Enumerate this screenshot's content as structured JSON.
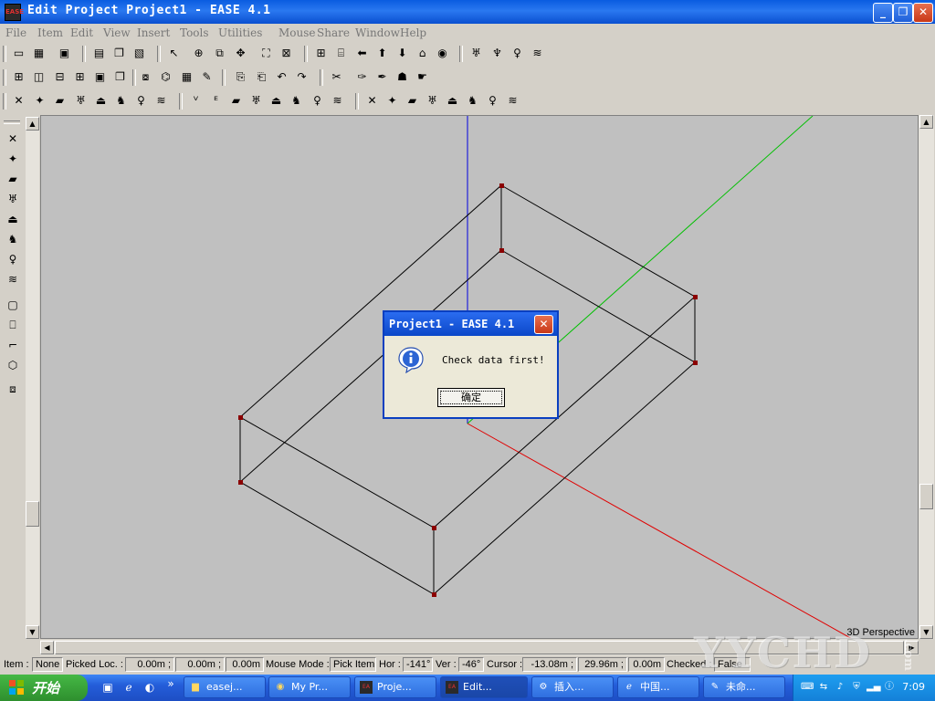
{
  "window": {
    "title": "Edit Project Project1 - EASE 4.1",
    "logo_text": "EASE",
    "controls": {
      "minimize": "_",
      "maximize": "❐",
      "close": "✕"
    }
  },
  "menu": [
    "File",
    "Item",
    "Edit",
    "View",
    "Insert",
    "Tools",
    "Utilities",
    "Mouse",
    "Share",
    "Window",
    "Help"
  ],
  "toolbars": {
    "row1": [
      "new-icon",
      "open-icon",
      "save-icon",
      "print-icon",
      "copy-icon",
      "paste-icon",
      "pick-icon",
      "target-icon",
      "zoom-box-icon",
      "move-icon",
      "fit-icon",
      "fullscreen-icon",
      "grid-icon",
      "table-icon",
      "arrow-left-icon",
      "arrow-up-icon",
      "arrow-down-icon",
      "home-icon",
      "globe-icon",
      "speaker-icon",
      "speaker-array-icon",
      "lamp-icon",
      "wave-icon"
    ],
    "row2": [
      "view-quad-icon",
      "view-left-icon",
      "view-right-icon",
      "view-front-icon",
      "view-top-icon",
      "view-back-icon",
      "render-icon",
      "frame-icon",
      "color-icon",
      "edit-icon",
      "page-icon",
      "page2-icon",
      "undo-icon",
      "redo-icon",
      "scissors-icon",
      "pen-icon",
      "marker-icon",
      "people-icon",
      "hand-icon"
    ],
    "row3": [
      "delete-vertex-icon",
      "insert-vertex-icon",
      "face-icon",
      "speaker-icon",
      "seat-icon",
      "chair-icon",
      "light-icon",
      "wave-icon",
      "select-vertex-icon",
      "select-edge-icon",
      "select-face-icon",
      "select-speaker-icon",
      "select-seat-icon",
      "select-chair-icon",
      "select-light-icon",
      "select-wave-icon",
      "mark-vertex-icon",
      "mark-edge-icon",
      "mark-face-icon",
      "mark-speaker-icon",
      "mark-seat-icon",
      "mark-chair-icon",
      "mark-light-icon",
      "mark-wave-icon"
    ]
  },
  "view": {
    "label": "3D Perspective",
    "axis_colors": {
      "x": "#e00000",
      "y": "#00c000",
      "z": "#0000e0"
    },
    "edge_color": "#000000",
    "vertex_color": "#8b0000",
    "background": "#c0c0c0"
  },
  "dialog": {
    "title": "Project1 - EASE 4.1",
    "message": "Check data first!",
    "ok_label": "确定",
    "close": "✕"
  },
  "status": {
    "item_label": "Item :",
    "item_value": "None",
    "picked_label": "Picked Loc. :",
    "picked_x": "0.00m ;",
    "picked_y": "0.00m ;",
    "picked_z": "0.00m",
    "mouse_mode_label": "Mouse Mode :",
    "mouse_mode_value": "Pick Item",
    "hor_label": "Hor :",
    "hor_value": "-141°",
    "ver_label": "Ver :",
    "ver_value": "-46°",
    "cursor_label": "Cursor :",
    "cursor_x": "-13.08m ;",
    "cursor_y": "29.96m ;",
    "cursor_z": "0.00m",
    "checked_label": "Checked :",
    "checked_value": "False"
  },
  "taskbar": {
    "start_label": "开始",
    "more": "»",
    "tasks": [
      {
        "label": "easej...",
        "icon": "folder-icon",
        "active": false
      },
      {
        "label": "My Pr...",
        "icon": "folder-icon",
        "active": false
      },
      {
        "label": "Proje...",
        "icon": "ease-icon",
        "active": false
      },
      {
        "label": "Edit...",
        "icon": "ease-icon",
        "active": true
      },
      {
        "label": "插入...",
        "icon": "app-icon",
        "active": false
      },
      {
        "label": "中国...",
        "icon": "ie-icon",
        "active": false
      },
      {
        "label": "未命...",
        "icon": "paint-icon",
        "active": false
      }
    ],
    "clock": "7:09"
  },
  "watermark": {
    "text": "YYCHD",
    "sub": ".com"
  }
}
